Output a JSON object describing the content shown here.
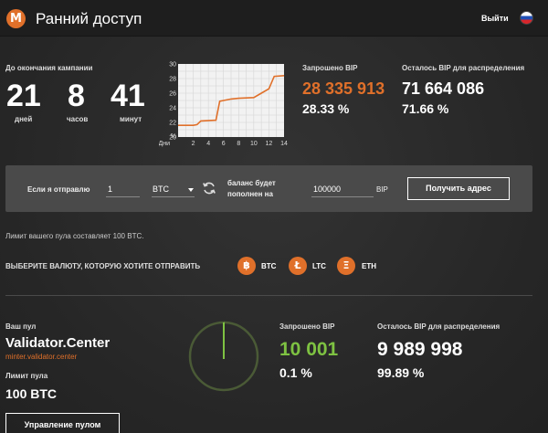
{
  "header": {
    "logo_letter": "M",
    "title": "Ранний доступ",
    "logout_label": "Выйти",
    "flag_icon": "russian-flag-icon"
  },
  "countdown": {
    "label": "До окончания кампании",
    "days": "21",
    "days_unit": "дней",
    "hours": "8",
    "hours_unit": "часов",
    "minutes": "41",
    "minutes_unit": "минут"
  },
  "chart_data": {
    "type": "line",
    "x_label": "Дни",
    "x_ticks": [
      "2",
      "4",
      "6",
      "8",
      "10",
      "12",
      "14"
    ],
    "y_ticks": [
      "30",
      "28",
      "26",
      "24",
      "22",
      "20"
    ],
    "y_unit": "%",
    "ylim": [
      20,
      30
    ],
    "xlim": [
      0,
      14
    ],
    "color": "#e0702a",
    "x": [
      0,
      2,
      2.5,
      3,
      5,
      5.5,
      6,
      7,
      8,
      10,
      11,
      12,
      12.7,
      14
    ],
    "y": [
      21.6,
      21.6,
      21.7,
      22.2,
      22.3,
      24.9,
      25.0,
      25.2,
      25.3,
      25.4,
      26.0,
      26.6,
      28.3,
      28.4
    ]
  },
  "stats": {
    "requested_label": "Запрошено BIP",
    "requested_value": "28 335 913",
    "requested_pct": "28.33 %",
    "remaining_label": "Осталось BIP для распределения",
    "remaining_value": "71 664 086",
    "remaining_pct": "71.66 %",
    "accent": "#e0702a"
  },
  "exchange": {
    "send_label": "Если я отправлю",
    "amount_value": "1",
    "currency_selected": "BTC",
    "swap_icon": "swap-arrows-icon",
    "balance_label_line1": "баланс будет",
    "balance_label_line2": "пополнен на",
    "result_value": "100000",
    "result_unit": "BIP",
    "get_address_label": "Получить адрес"
  },
  "note": "Лимит вашего пула составляет 100 BTC.",
  "currency_choice": {
    "label": "ВЫБЕРИТЕ ВАЛЮТУ, КОТОРУЮ ХОТИТЕ ОТПРАВИТЬ",
    "coins": [
      {
        "symbol": "฿",
        "label": "BTC"
      },
      {
        "symbol": "Ł",
        "label": "LTC"
      },
      {
        "symbol": "Ξ",
        "label": "ETH"
      }
    ]
  },
  "pool": {
    "your_pool_label": "Ваш пул",
    "name": "Validator.Center",
    "url": "minter.validator.center",
    "limit_label": "Лимит пула",
    "limit_value": "100 BTC",
    "manage_label": "Управление пулом",
    "requested_label": "Запрошено BIP",
    "requested_value": "10 001",
    "requested_pct": "0.1 %",
    "remaining_label": "Осталось BIP для распределения",
    "remaining_value": "9 989 998",
    "remaining_pct": "99.89 %",
    "accent": "#7ec242",
    "gauge_fraction": 0.001
  }
}
